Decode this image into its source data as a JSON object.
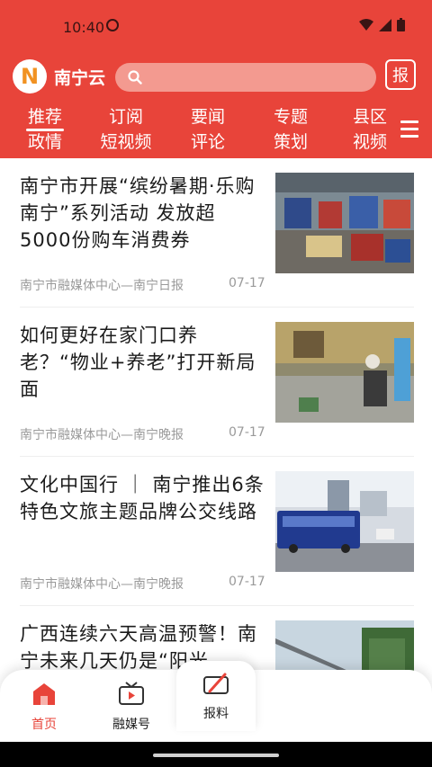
{
  "status": {
    "time": "10:40"
  },
  "header": {
    "logo_text": "南宁云",
    "logo_glyph": "N",
    "report_glyph": "报",
    "colors": {
      "brand": "#e8443a",
      "logo_orange": "#f19222"
    }
  },
  "channels": [
    {
      "line1": "推荐",
      "line2": "政情",
      "active": true
    },
    {
      "line1": "订阅",
      "line2": "短视频"
    },
    {
      "line1": "要闻",
      "line2": "评论"
    },
    {
      "line1": "专题",
      "line2": "策划"
    },
    {
      "line1": "县区",
      "line2": "视频"
    }
  ],
  "news": [
    {
      "title": "南宁市开展“缤纷暑期·乐购南宁”系列活动 发放超5000份购车消费券",
      "source": "南宁市融媒体中心—南宁日报",
      "date": "07-17"
    },
    {
      "title": "如何更好在家门口养老？“物业+养老”打开新局面",
      "source": "南宁市融媒体中心—南宁晚报",
      "date": "07-17"
    },
    {
      "title": "文化中国行 ｜ 南宁推出6条特色文旅主题品牌公交线路",
      "source": "南宁市融媒体中心—南宁晚报",
      "date": "07-17"
    },
    {
      "title": "广西连续六天高温预警！南宁未来几天仍是“阳光",
      "source": "",
      "date": ""
    }
  ],
  "tabbar": {
    "home": "首页",
    "media": "融媒号",
    "report": "报料"
  }
}
